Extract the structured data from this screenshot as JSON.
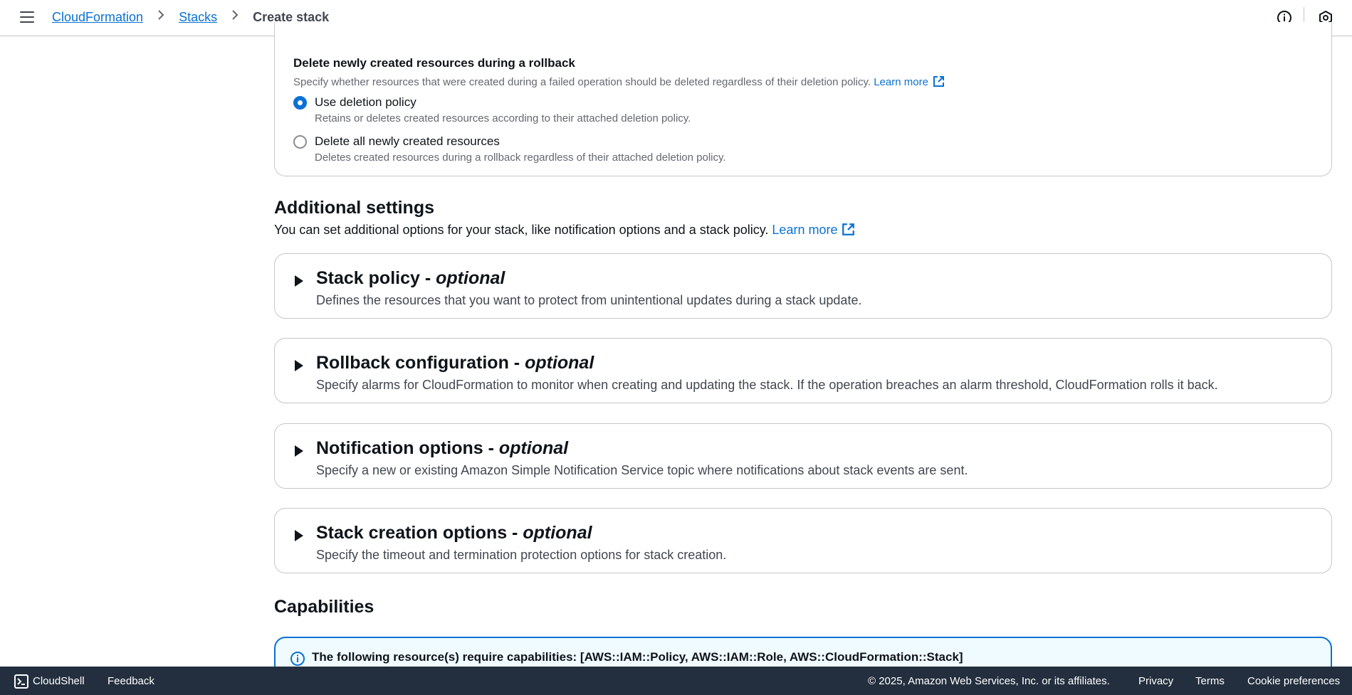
{
  "header": {
    "breadcrumbs": [
      "CloudFormation",
      "Stacks"
    ],
    "current_page": "Create stack",
    "menu_icon": "hamburger-menu-icon",
    "info_icon": "info-icon",
    "settings_icon": "hexagon-settings-icon"
  },
  "rollback_deletion": {
    "title": "Delete newly created resources during a rollback",
    "description": "Specify whether resources that were created during a failed operation should be deleted regardless of their deletion policy.",
    "learn_more": "Learn more",
    "options": [
      {
        "label": "Use deletion policy",
        "description": "Retains or deletes created resources according to their attached deletion policy.",
        "selected": true
      },
      {
        "label": "Delete all newly created resources",
        "description": "Deletes created resources during a rollback regardless of their attached deletion policy.",
        "selected": false
      }
    ]
  },
  "additional_settings": {
    "heading": "Additional settings",
    "description": "You can set additional options for your stack, like notification options and a stack policy.",
    "learn_more": "Learn more",
    "sections": [
      {
        "title": "Stack policy - ",
        "optional": "optional",
        "description": "Defines the resources that you want to protect from unintentional updates during a stack update."
      },
      {
        "title": "Rollback configuration - ",
        "optional": "optional",
        "description": "Specify alarms for CloudFormation to monitor when creating and updating the stack. If the operation breaches an alarm threshold, CloudFormation rolls it back."
      },
      {
        "title": "Notification options - ",
        "optional": "optional",
        "description": "Specify a new or existing Amazon Simple Notification Service topic where notifications about stack events are sent."
      },
      {
        "title": "Stack creation options - ",
        "optional": "optional",
        "description": "Specify the timeout and termination protection options for stack creation."
      }
    ]
  },
  "capabilities": {
    "heading": "Capabilities",
    "alert_text": "The following resource(s) require capabilities: [AWS::IAM::Policy, AWS::IAM::Role, AWS::CloudFormation::Stack]"
  },
  "footer": {
    "cloudshell": "CloudShell",
    "feedback": "Feedback",
    "copyright": "© 2025, Amazon Web Services, Inc. or its affiliates.",
    "privacy": "Privacy",
    "terms": "Terms",
    "cookie_preferences": "Cookie preferences"
  },
  "colors": {
    "link": "#0972d3",
    "footer_bg": "#232f3e",
    "alert_bg": "#f0fbff"
  }
}
